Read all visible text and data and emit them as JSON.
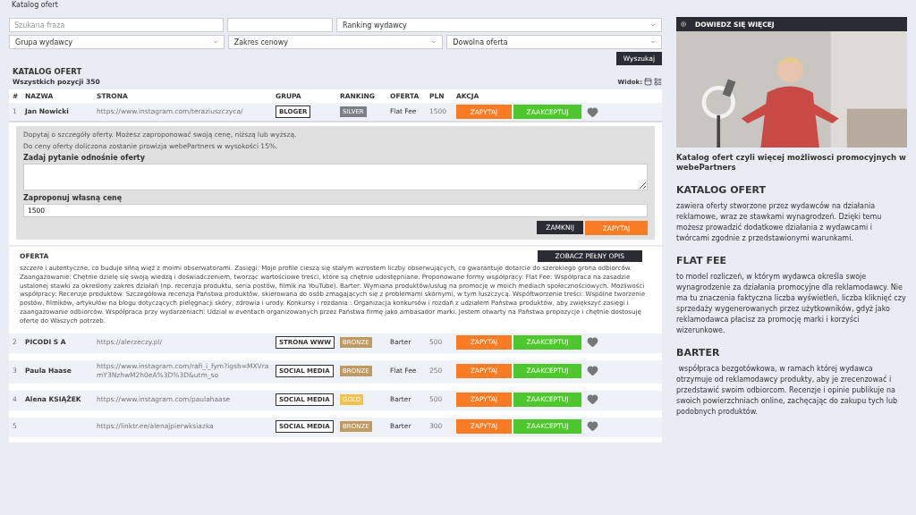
{
  "page_title": "Katalog ofert",
  "filters": {
    "search": {
      "placeholder": "Szukana fraza"
    },
    "ranking": {
      "value": "Ranking wydawcy"
    },
    "group": {
      "value": "Grupa wydawcy"
    },
    "price": {
      "value": "Zakres cenowy"
    },
    "offer": {
      "value": "Dowolna oferta"
    },
    "search_button": "Wyszukaj"
  },
  "catalog": {
    "title": "KATALOG OFERT",
    "count": "Wszystkich pozycji 350",
    "view_label": "Widok:"
  },
  "table": {
    "columns": [
      "#",
      "NAZWA",
      "STRONA",
      "GRUPA",
      "RANKING",
      "OFERTA",
      "PLN",
      "AKCJA"
    ],
    "rows": [
      {
        "num": "1",
        "name": "Jan Nowicki",
        "url": "https://www.instagram.com/teraziuszczyca/",
        "group": "BLOGER",
        "ranking": {
          "label": "SILVER",
          "color": "#7d7f86"
        },
        "offer": "Flat Fee",
        "price": "1500",
        "ask": "ZAPYTAJ",
        "accept": "ZAAKCEPTUJ",
        "expanded": true
      },
      {
        "num": "2",
        "name": "PICODI S A",
        "url": "https://alerzeczy.pl/",
        "group": "STRONA WWW",
        "ranking": {
          "label": "BRONZE",
          "color": "#c09a63"
        },
        "offer": "Barter",
        "price": "500",
        "ask": "ZAPYTAJ",
        "accept": "ZAAKCEPTUJ",
        "expanded": false
      },
      {
        "num": "3",
        "name": "Paula Haase",
        "url": "https://www.instagram.com/rafi_i_fym?igsh=MXVramY3NzhwM2h0eA%3D%3D&utm_so",
        "group": "SOCIAL MEDIA",
        "ranking": {
          "label": "BRONZE",
          "color": "#c09a63"
        },
        "offer": "Flat Fee",
        "price": "250",
        "ask": "ZAPYTAJ",
        "accept": "ZAAKCEPTUJ",
        "expanded": false
      },
      {
        "num": "4",
        "name": "Alena KSIĄŻEK",
        "url": "https://www.instagram.com/paulahaase",
        "group": "SOCIAL MEDIA",
        "ranking": {
          "label": "GOLD",
          "color": "#f3c14c"
        },
        "offer": "Barter",
        "price": "500",
        "ask": "ZAPYTAJ",
        "accept": "ZAAKCEPTUJ",
        "expanded": false
      },
      {
        "num": "5",
        "url": "https://linktr.ee/alenajpierwksiazka",
        "group": "SOCIAL MEDIA",
        "ranking": {
          "label": "BRONZE",
          "color": "#c09a63"
        },
        "offer": "Barter",
        "price": "300",
        "ask": "ZAPYTAJ",
        "accept": "ZAAKCEPTUJ",
        "expanded": false
      }
    ]
  },
  "inquiry": {
    "info": [
      "Dopytaj o szczegóły oferty. Możesz zaproponować swoją cenę, niższą lub wyższą.",
      "Do ceny oferty doliczona zostanie prowizja webePartners w wysokości 15%."
    ],
    "question_label": "Zadaj pytanie odnośnie oferty",
    "price_label": "Zaproponuj własną cenę",
    "price_value": "1500",
    "close_button": "ZAMKNIJ",
    "ask_button": "ZAPYTAJ"
  },
  "offer_details": {
    "title": "OFERTA",
    "button": "ZOBACZ PEŁNY OPIS",
    "text": "szczere i autentyczne, co buduje silną więź z moimi obserwatorami. Zasięgi: Moje profile cieszą się stałym wzrostem liczby obserwujących, co gwarantuje dotarcie do szerokiego grona odbiorców. Zaangażowanie: Chętnie dzielę się swoją wiedzą i doświadczeniem, tworząc wartościowe treści, które są chętnie udostępniane. Proponowane formy współpracy: Flat Fee: Współpraca na zasadzie ustalonej stawki za określony zakres działań (np. recenzja produktu, seria postów, filmik na YouTube). Barter: Wymiana produktów/usług na promocję w moich mediach społecznościowych. Możliwości współpracy: Recenzje produktów: Szczegółowa recenzja Państwa produktów, skierowana do osób zmagających się z problemami skórnymi, w tym łuszczycą. Współtworzenie treści: Wspólne tworzenie postów, filmików, artykułów na blogu dotyczących pielęgnacji skóry, zdrowia i urody. Konkursy i rozdania : Organizacja konkursów i rozdań z udziałem Państwa produktów, aby zwiększyć zasięgi i zaangażowanie odbiorców. Współpraca przy wydarzeniach: Udział w eventach organizowanych przez Państwa firmę jako ambasador marki. Jestem otwarty na Państwa propozycje i chętnie dostosuję ofertę do Waszych potrzeb."
  },
  "sidebar": {
    "video": {
      "header": "DOWIEDZ SIĘ WIĘCEJ",
      "caption": "Katalog ofert czyli więcej możliwosci promocyjnych w webePartners"
    },
    "sections": [
      {
        "title": "KATALOG OFERT",
        "text": "zawiera oferty stworzone przez wydawców na działania reklamowe, wraz ze stawkami wynagrodzeń. Dzięki temu możesz prowadzić dodatkowe działania z wydawcami i twórcami zgodnie z przedstawionymi warunkami."
      },
      {
        "title": "FLAT FEE",
        "text": "to model rozliczeń, w którym wydawca określa swoje  wynagrodzenie za działania promocyjne dla reklamodawcy. Nie ma tu znaczenia faktyczna liczba wyświetleń, liczba kliknięć czy sprzedaży wygenerowanych przez użytkowników, gdyż jako reklamodawca płacisz za promocję marki i korzyści wizerunkowe."
      },
      {
        "title": "BARTER",
        "text": " współpraca bezgotówkowa, w ramach której wydawca  otrzymuje od reklamodawcy produkty, aby je zrecenzować i przedstawić swoim odbiorcom. Recenzje i opinie publikuje na swoich powierzchniach online, zachęcając do zakupu tych lub podobnych produktów."
      }
    ]
  }
}
